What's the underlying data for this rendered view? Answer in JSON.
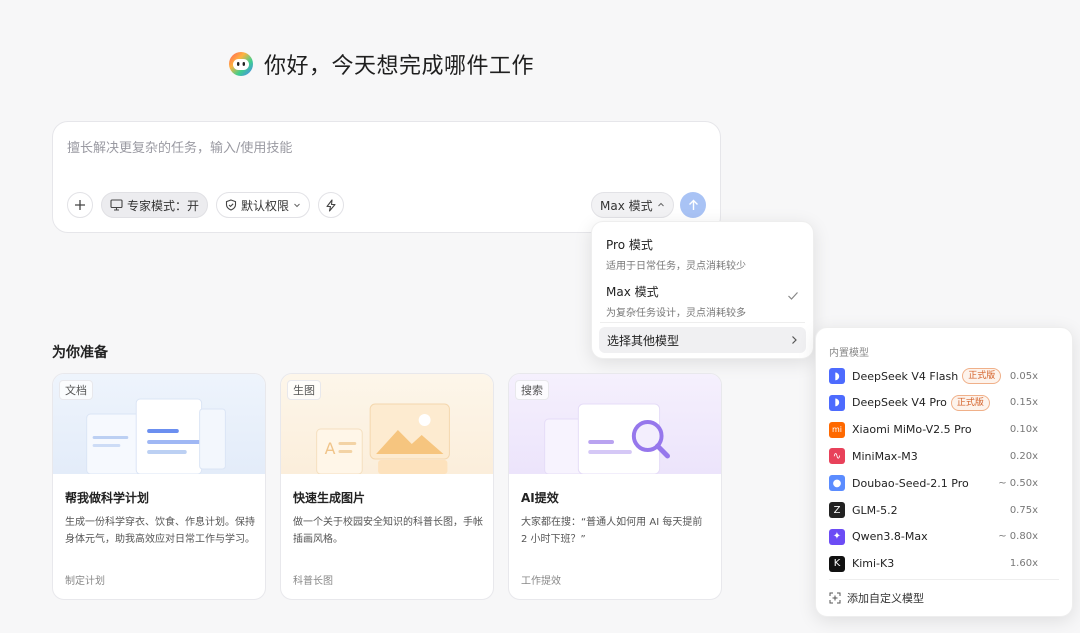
{
  "greeting": "你好，今天想完成哪件工作",
  "composer": {
    "placeholder": "擅长解决更复杂的任务，输入/使用技能",
    "expert_mode_label": "专家模式：开",
    "permission_label": "默认权限",
    "mode_label": "Max 模式"
  },
  "mode_menu": {
    "items": [
      {
        "title": "Pro 模式",
        "desc": "适用于日常任务，灵点消耗较少"
      },
      {
        "title": "Max 模式",
        "desc": "为复杂任务设计，灵点消耗较多",
        "selected": true
      }
    ],
    "other_label": "选择其他模型"
  },
  "model_menu": {
    "header": "内置模型",
    "models": [
      {
        "name": "DeepSeek V4 Flash",
        "badge": "正式版",
        "rate": "0.05x",
        "icon": "deepseek-whale-icon",
        "color": "#4d6bfe"
      },
      {
        "name": "DeepSeek V4 Pro",
        "badge": "正式版",
        "rate": "0.15x",
        "icon": "deepseek-whale-icon",
        "color": "#4d6bfe"
      },
      {
        "name": "Xiaomi MiMo-V2.5 Pro",
        "badge": "",
        "rate": "0.10x",
        "icon": "xiaomi-icon",
        "color": "#ff6900"
      },
      {
        "name": "MiniMax-M3",
        "badge": "",
        "rate": "0.20x",
        "icon": "minimax-wave-icon",
        "color": "#e8415a"
      },
      {
        "name": "Doubao-Seed-2.1 Pro",
        "badge": "",
        "rate": "~ 0.50x",
        "icon": "doubao-icon",
        "color": "#5b8cff"
      },
      {
        "name": "GLM-5.2",
        "badge": "",
        "rate": "0.75x",
        "icon": "zhipu-z-icon",
        "color": "#222222"
      },
      {
        "name": "Qwen3.8-Max",
        "badge": "",
        "rate": "~ 0.80x",
        "icon": "qwen-icon",
        "color": "#6c4cf5"
      },
      {
        "name": "Kimi-K3",
        "badge": "",
        "rate": "1.60x",
        "icon": "kimi-k-icon",
        "color": "#111111"
      }
    ],
    "add_label": "添加自定义模型"
  },
  "section_title": "为你准备",
  "cards": [
    {
      "tag": "文档",
      "title": "帮我做科学计划",
      "desc": "生成一份科学穿衣、饮食、作息计划。保持身体元气，助我高效应对日常工作与学习。",
      "foot": "制定计划"
    },
    {
      "tag": "生图",
      "title": "快速生成图片",
      "desc": "做一个关于校园安全知识的科普长图，手帐插画风格。",
      "foot": "科普长图"
    },
    {
      "tag": "搜索",
      "title": "AI提效",
      "desc": "大家都在搜：“普通人如何用 AI 每天提前 2 小时下班？”",
      "foot": "工作提效"
    }
  ],
  "colors": {
    "accent": "#a9c3f5",
    "badge": "#d4622a"
  }
}
